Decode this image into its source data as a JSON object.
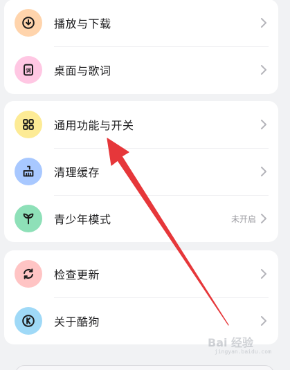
{
  "colors": {
    "page_bg": "#f1f2f4",
    "card_bg": "#ffffff",
    "arrow": "#e6373a"
  },
  "groups": [
    {
      "items": [
        {
          "label": "播放与下载",
          "icon": "download-icon",
          "icon_bg": "#ffd4ac"
        },
        {
          "label": "桌面与歌词",
          "icon": "lyrics-icon",
          "icon_bg": "#ffc7e3"
        }
      ]
    },
    {
      "items": [
        {
          "label": "通用功能与开关",
          "icon": "grid-icon",
          "icon_bg": "#fdeb95"
        },
        {
          "label": "清理缓存",
          "icon": "broom-icon",
          "icon_bg": "#a8c8ff"
        },
        {
          "label": "青少年模式",
          "icon": "sprout-icon",
          "icon_bg": "#8ee0b8",
          "status": "未开启"
        }
      ]
    },
    {
      "items": [
        {
          "label": "检查更新",
          "icon": "refresh-icon",
          "icon_bg": "#ffc4c4"
        },
        {
          "label": "关于酷狗",
          "icon": "kugou-logo-icon",
          "icon_bg": "#9fd9f7"
        }
      ]
    }
  ],
  "watermark": {
    "text": "Bai 经验",
    "sub": "jingyan.baidu.com"
  }
}
